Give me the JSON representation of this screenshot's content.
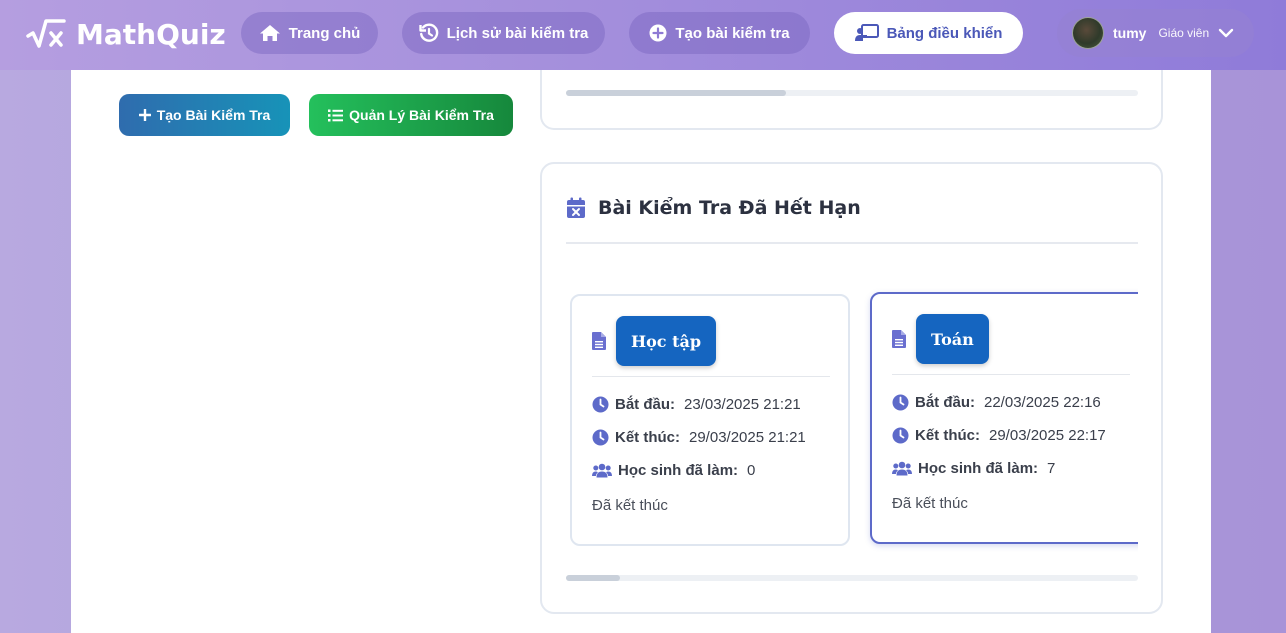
{
  "brand": {
    "name": "MathQuiz",
    "icon": "square-root-x-icon"
  },
  "nav": {
    "items": [
      {
        "label": "Trang chủ",
        "icon": "home-icon"
      },
      {
        "label": "Lịch sử bài kiểm tra",
        "icon": "history-icon"
      },
      {
        "label": "Tạo bài kiểm tra",
        "icon": "plus-circle-icon"
      },
      {
        "label": "Bảng điều khiển",
        "icon": "chalkboard-teacher-icon",
        "active": true
      }
    ]
  },
  "user": {
    "name": "tumy",
    "role": "Giáo viên"
  },
  "actions": {
    "create_label": "Tạo Bài Kiểm Tra",
    "manage_label": "Quản Lý Bài Kiểm Tra"
  },
  "expired": {
    "title": "Bài Kiểm Tra Đã Hết Hạn",
    "start_label": "Bắt đầu:",
    "end_label": "Kết thúc:",
    "students_label": "Học sinh đã làm:",
    "quizzes": [
      {
        "subject": "Học tập",
        "start": "23/03/2025 21:21",
        "end": "29/03/2025 21:21",
        "students": "0",
        "status": "Đã kết thúc"
      },
      {
        "subject": "Toán",
        "start": "22/03/2025 22:16",
        "end": "29/03/2025 22:17",
        "students": "7",
        "status": "Đã kết thúc"
      }
    ]
  },
  "colors": {
    "accent": "#5d6ac9",
    "badge": "#1565c0",
    "icon": "#6a6fd0"
  }
}
